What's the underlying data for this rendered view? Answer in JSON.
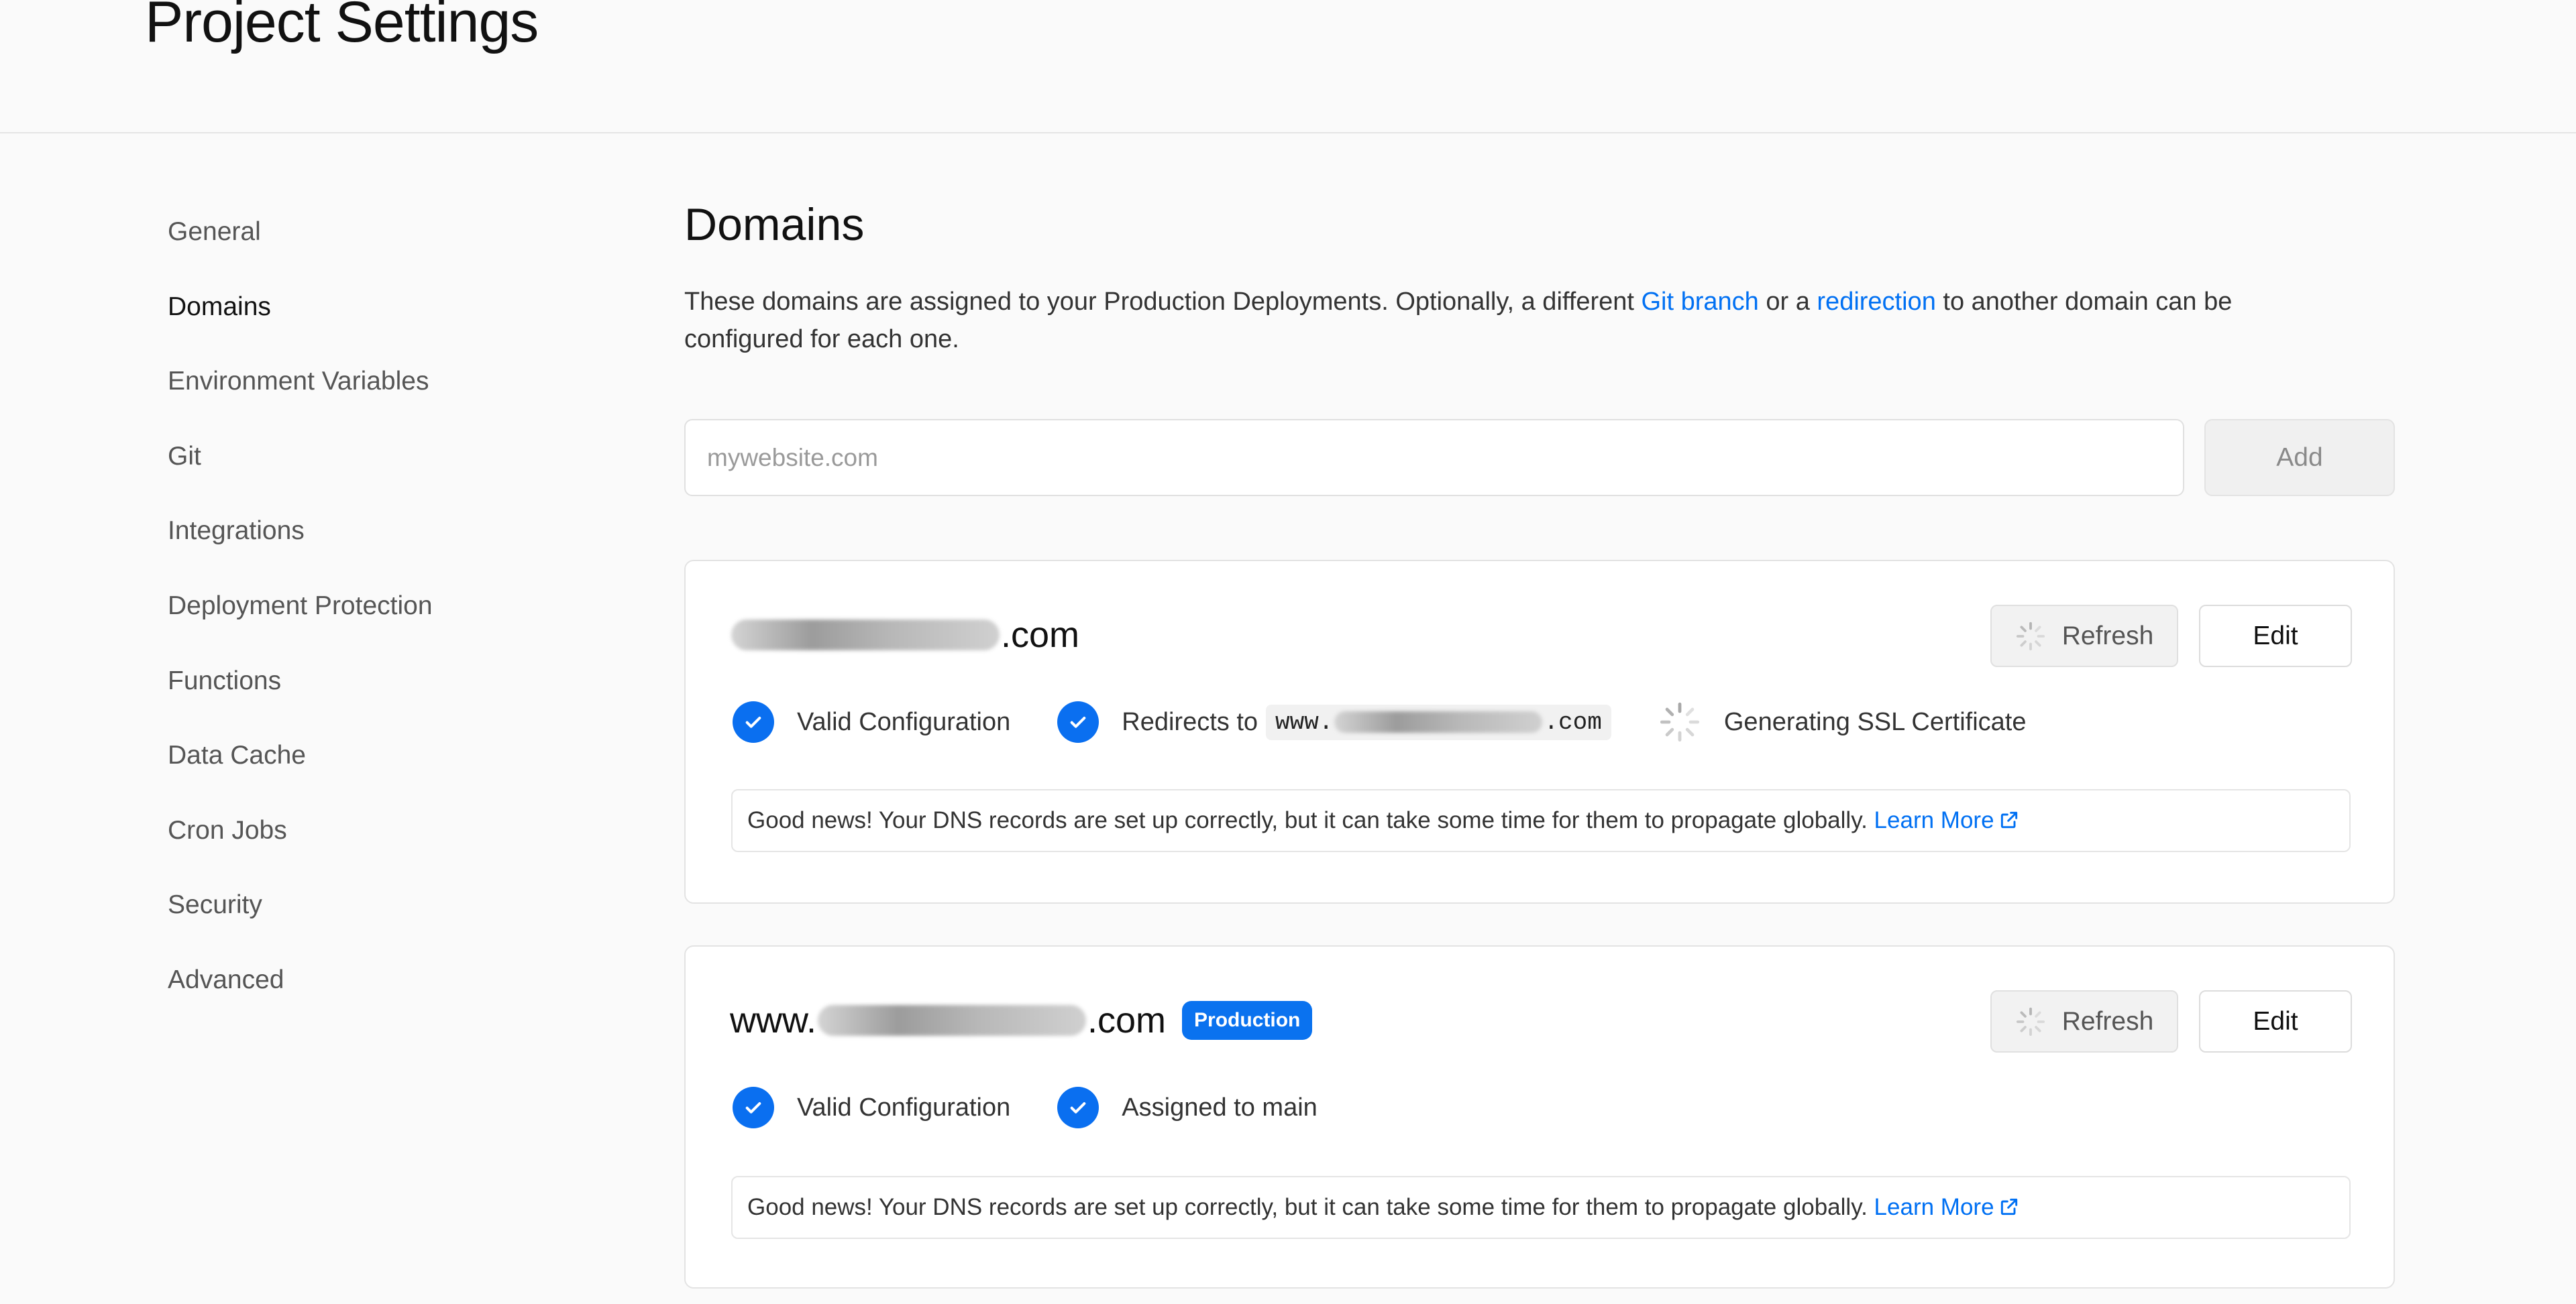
{
  "header": {
    "title": "Project Settings"
  },
  "sidebar": {
    "items": [
      {
        "label": "General",
        "active": false
      },
      {
        "label": "Domains",
        "active": true
      },
      {
        "label": "Environment Variables",
        "active": false
      },
      {
        "label": "Git",
        "active": false
      },
      {
        "label": "Integrations",
        "active": false
      },
      {
        "label": "Deployment Protection",
        "active": false
      },
      {
        "label": "Functions",
        "active": false
      },
      {
        "label": "Data Cache",
        "active": false
      },
      {
        "label": "Cron Jobs",
        "active": false
      },
      {
        "label": "Security",
        "active": false
      },
      {
        "label": "Advanced",
        "active": false
      }
    ]
  },
  "main": {
    "title": "Domains",
    "description": {
      "part1": "These domains are assigned to your Production Deployments. Optionally, a different ",
      "link1": "Git branch",
      "part2": " or a ",
      "link2": "redirection",
      "part3": " to another domain can be configured for each one."
    },
    "add_domain": {
      "placeholder": "mywebsite.com",
      "value": "",
      "button_label": "Add"
    }
  },
  "domains": [
    {
      "name_suffix": ".com",
      "refresh_label": "Refresh",
      "edit_label": "Edit",
      "statuses": {
        "valid": "Valid Configuration",
        "redirect_label": "Redirects to",
        "redirect_prefix": "www.",
        "redirect_suffix": ".com",
        "ssl": "Generating SSL Certificate"
      },
      "notice": "Good news! Your DNS records are set up correctly, but it can take some time for them to propagate globally. ",
      "notice_link": "Learn More"
    },
    {
      "name_prefix": "www.",
      "name_suffix": ".com",
      "badge": "Production",
      "refresh_label": "Refresh",
      "edit_label": "Edit",
      "statuses": {
        "valid": "Valid Configuration",
        "assigned": "Assigned to main"
      },
      "notice": "Good news! Your DNS records are set up correctly, but it can take some time for them to propagate globally. ",
      "notice_link": "Learn More"
    }
  ],
  "colors": {
    "accent": "#0070f3",
    "check": "#0a6ff0",
    "badge": "#0a72ef"
  },
  "icons": [
    "check-icon",
    "spinner-icon",
    "external-link-icon"
  ]
}
